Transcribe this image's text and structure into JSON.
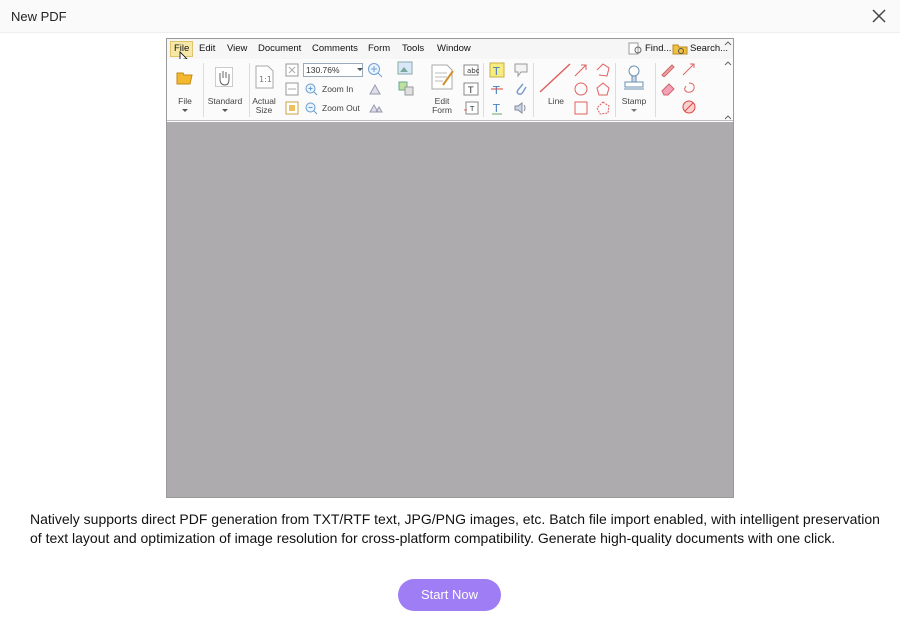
{
  "window": {
    "title": "New PDF"
  },
  "preview": {
    "menu": [
      "File",
      "Edit",
      "View",
      "Document",
      "Comments",
      "Form",
      "Tools",
      "Window"
    ],
    "find_label": "Find...",
    "search_label": "Search...",
    "zoom_value": "130.76%",
    "zoom_in_label": "Zoom In",
    "zoom_out_label": "Zoom Out",
    "tools": {
      "file": "File",
      "standard": "Standard",
      "actual_1": "Actual",
      "actual_2": "Size",
      "edit_1": "Edit",
      "edit_2": "Form",
      "line": "Line",
      "stamp": "Stamp"
    }
  },
  "description": "Natively supports direct PDF generation from TXT/RTF text, JPG/PNG images, etc. Batch file import enabled, with intelligent preservation of text layout and optimization of image resolution for cross-platform compatibility. Generate high-quality documents with one click.",
  "start_button": "Start Now",
  "colors": {
    "accent": "#9e7df5",
    "canvas": "#adabad"
  }
}
